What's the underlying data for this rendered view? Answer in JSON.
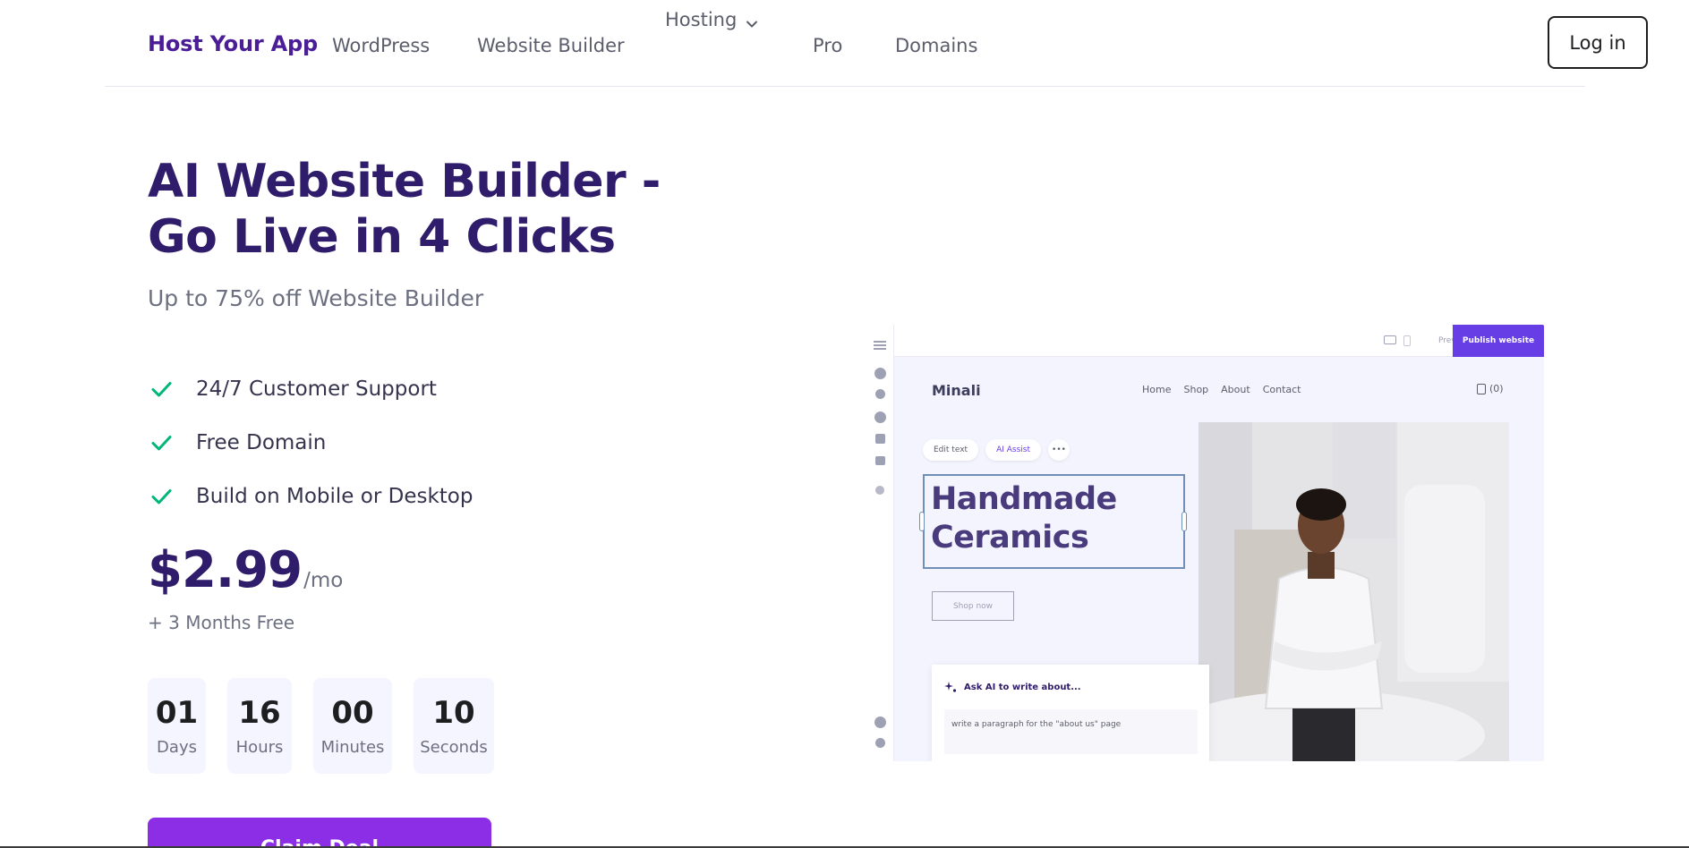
{
  "nav": {
    "brand": "Host Your App",
    "links": [
      "WordPress",
      "Website Builder",
      "Hosting",
      "Pro",
      "Domains"
    ],
    "login": "Log in"
  },
  "hero": {
    "title": "AI Website Builder - Go Live in 4 Clicks",
    "subtitle": "Up to 75% off Website Builder",
    "features": [
      "24/7 Customer Support",
      "Free Domain",
      "Build on Mobile or Desktop"
    ],
    "price": "$2.99",
    "price_unit": "/mo",
    "bonus": "+ 3 Months Free",
    "countdown": [
      {
        "value": "01",
        "label": "Days"
      },
      {
        "value": "16",
        "label": "Hours"
      },
      {
        "value": "00",
        "label": "Minutes"
      },
      {
        "value": "10",
        "label": "Seconds"
      }
    ],
    "cta": "Claim Deal"
  },
  "mockup": {
    "preview": "Preview",
    "publish": "Publish website",
    "logo": "Minali",
    "nav": [
      "Home",
      "Shop",
      "About",
      "Contact"
    ],
    "cart": "(0)",
    "edit_text": "Edit text",
    "ai_assist": "AI Assist",
    "more": "•••",
    "heading_line1": "Handmade",
    "heading_line2": "Ceramics",
    "shop_now": "Shop now",
    "ai_prompt_title": "Ask AI to write about...",
    "ai_prompt_text": "write a paragraph for the \"about us\" page"
  },
  "colors": {
    "brand": "#4b1d96",
    "title": "#2f1c6a",
    "check": "#00b67a",
    "cta": "#8c2ee6",
    "mock_publish": "#673de6"
  },
  "icons": {
    "hosting_dropdown": "chevron-down-icon",
    "feature_check": "check-icon"
  }
}
